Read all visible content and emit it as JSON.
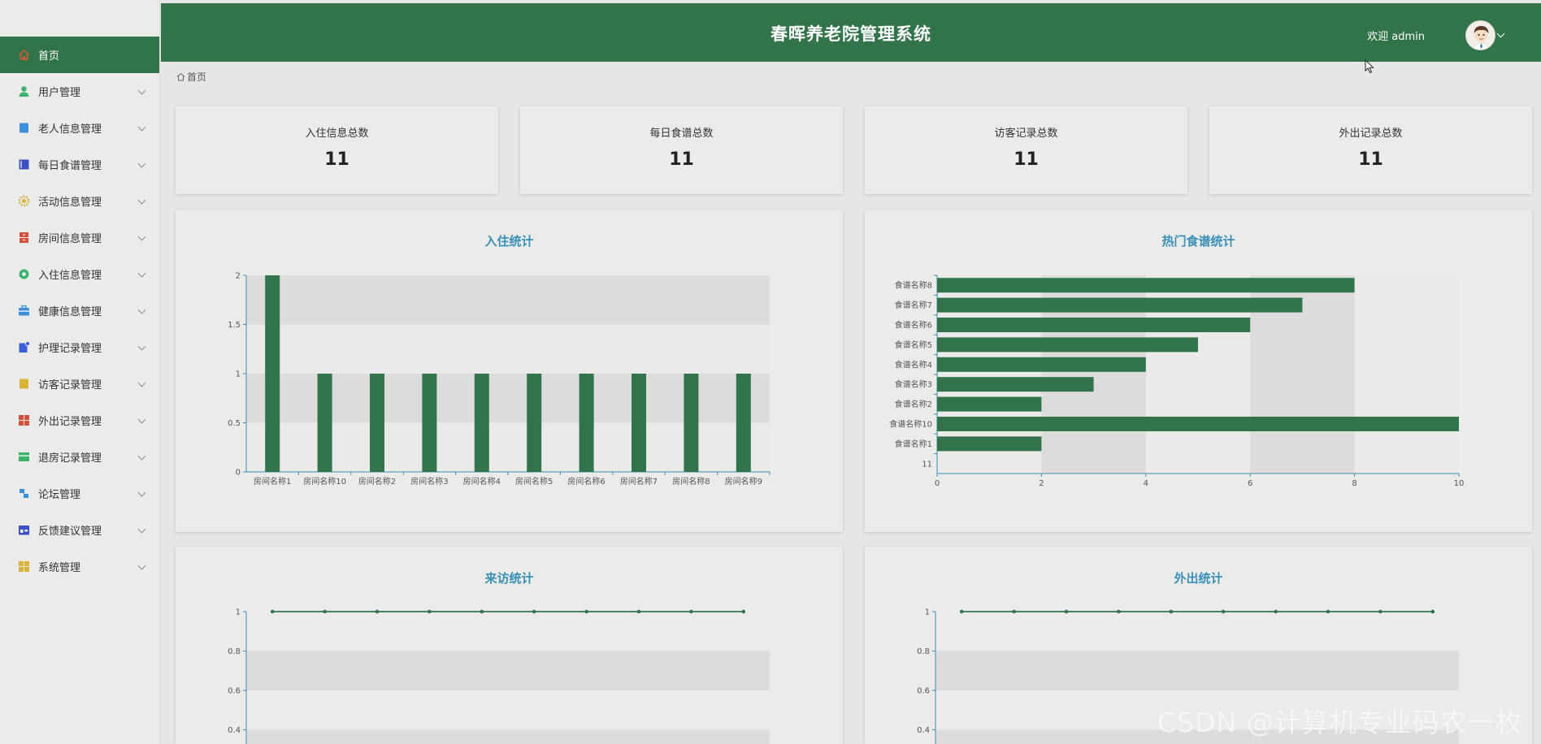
{
  "app": {
    "title": "春晖养老院管理系统",
    "welcome": "欢迎 admin"
  },
  "breadcrumb": {
    "home": "首页"
  },
  "sidebar": {
    "items": [
      {
        "label": "首页",
        "icon": "home-icon",
        "color": "#e0573a",
        "active": true
      },
      {
        "label": "用户管理",
        "icon": "user-icon",
        "color": "#3bb36a"
      },
      {
        "label": "老人信息管理",
        "icon": "book-icon",
        "color": "#3c8fd8"
      },
      {
        "label": "每日食谱管理",
        "icon": "list-icon",
        "color": "#3a4fc4"
      },
      {
        "label": "活动信息管理",
        "icon": "gear-icon",
        "color": "#d8b33a"
      },
      {
        "label": "房间信息管理",
        "icon": "cabinet-icon",
        "color": "#d4503a"
      },
      {
        "label": "入住信息管理",
        "icon": "circle-icon",
        "color": "#3bb36a"
      },
      {
        "label": "健康信息管理",
        "icon": "briefcase-icon",
        "color": "#3c8fd8"
      },
      {
        "label": "护理记录管理",
        "icon": "note-icon",
        "color": "#3a5fd8"
      },
      {
        "label": "访客记录管理",
        "icon": "document-icon",
        "color": "#d8b33a"
      },
      {
        "label": "外出记录管理",
        "icon": "grid-icon",
        "color": "#d4503a"
      },
      {
        "label": "退房记录管理",
        "icon": "box-icon",
        "color": "#3bb36a"
      },
      {
        "label": "论坛管理",
        "icon": "forum-icon",
        "color": "#3c8fd8"
      },
      {
        "label": "反馈建议管理",
        "icon": "store-icon",
        "color": "#3a4fc4"
      },
      {
        "label": "系统管理",
        "icon": "grid-icon",
        "color": "#d8b33a"
      }
    ]
  },
  "stats": [
    {
      "label": "入住信息总数",
      "value": "11"
    },
    {
      "label": "每日食谱总数",
      "value": "11"
    },
    {
      "label": "访客记录总数",
      "value": "11"
    },
    {
      "label": "外出记录总数",
      "value": "11"
    }
  ],
  "colors": {
    "primary": "#32744a",
    "title": "#3a8fb7"
  },
  "watermark": "CSDN @计算机专业码农一枚",
  "chart_data": [
    {
      "type": "bar",
      "title": "入住统计",
      "categories": [
        "房间名称1",
        "房间名称10",
        "房间名称2",
        "房间名称3",
        "房间名称4",
        "房间名称5",
        "房间名称6",
        "房间名称7",
        "房间名称8",
        "房间名称9"
      ],
      "values": [
        2,
        1,
        1,
        1,
        1,
        1,
        1,
        1,
        1,
        1
      ],
      "ylim": [
        0,
        2
      ],
      "yticks": [
        "0",
        "0.5",
        "1",
        "1.5",
        "2"
      ],
      "color": "#32744a"
    },
    {
      "type": "bar",
      "orientation": "horizontal",
      "title": "热门食谱统计",
      "categories": [
        "11",
        "食谱名称1",
        "食谱名称10",
        "食谱名称2",
        "食谱名称3",
        "食谱名称4",
        "食谱名称5",
        "食谱名称6",
        "食谱名称7",
        "食谱名称8"
      ],
      "values": [
        0,
        2,
        10,
        2,
        3,
        4,
        5,
        6,
        7,
        8
      ],
      "xlim": [
        0,
        10
      ],
      "xticks": [
        "0",
        "2",
        "4",
        "6",
        "8",
        "10"
      ],
      "color": "#32744a"
    },
    {
      "type": "line",
      "title": "来访统计",
      "values": [
        1,
        1,
        1,
        1,
        1,
        1,
        1,
        1,
        1,
        1
      ],
      "yticks": [
        "1",
        "0.8",
        "0.6",
        "0.4"
      ],
      "color": "#32744a"
    },
    {
      "type": "line",
      "title": "外出统计",
      "values": [
        1,
        1,
        1,
        1,
        1,
        1,
        1,
        1,
        1,
        1
      ],
      "yticks": [
        "1",
        "0.8",
        "0.6",
        "0.4"
      ],
      "color": "#32744a"
    }
  ]
}
